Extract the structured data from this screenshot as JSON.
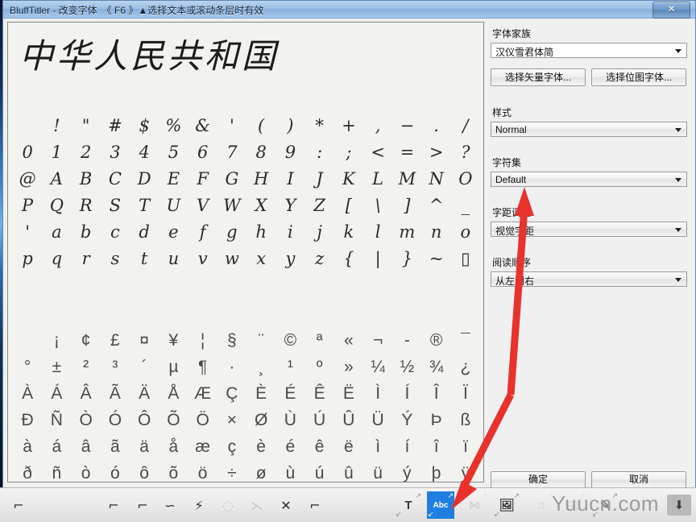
{
  "window": {
    "title": "BluffTitler - 改变字体　《 F6 》▲选择文本或滚动条层时有效",
    "close_label": "✕",
    "close_icon": "close-icon"
  },
  "preview": {
    "text": "中华人民共和国"
  },
  "charmap": {
    "columns": 16,
    "ascii_rows": [
      [
        " ",
        "!",
        "\"",
        "#",
        "$",
        "%",
        "&",
        "'",
        "(",
        ")",
        "*",
        "+",
        ",",
        "−",
        ".",
        "/"
      ],
      [
        "0",
        "1",
        "2",
        "3",
        "4",
        "5",
        "6",
        "7",
        "8",
        "9",
        ":",
        ";",
        "<",
        "=",
        ">",
        "?"
      ],
      [
        "@",
        "A",
        "B",
        "C",
        "D",
        "E",
        "F",
        "G",
        "H",
        "I",
        "J",
        "K",
        "L",
        "M",
        "N",
        "O"
      ],
      [
        "P",
        "Q",
        "R",
        "S",
        "T",
        "U",
        "V",
        "W",
        "X",
        "Y",
        "Z",
        "[",
        "\\",
        "]",
        "^",
        "_"
      ],
      [
        "'",
        "a",
        "b",
        "c",
        "d",
        "e",
        "f",
        "g",
        "h",
        "i",
        "j",
        "k",
        "l",
        "m",
        "n",
        "o"
      ],
      [
        "p",
        "q",
        "r",
        "s",
        "t",
        "u",
        "v",
        "w",
        "x",
        "y",
        "z",
        "{",
        "|",
        "}",
        "~",
        "▯"
      ]
    ],
    "latin_rows": [
      [
        " ",
        "¡",
        "¢",
        "£",
        "¤",
        "¥",
        "¦",
        "§",
        "¨",
        "©",
        "ª",
        "«",
        "¬",
        "-",
        "®",
        "¯"
      ],
      [
        "°",
        "±",
        "²",
        "³",
        "´",
        "µ",
        "¶",
        "·",
        "¸",
        "¹",
        "º",
        "»",
        "¼",
        "½",
        "¾",
        "¿"
      ],
      [
        "À",
        "Á",
        "Â",
        "Ã",
        "Ä",
        "Å",
        "Æ",
        "Ç",
        "È",
        "É",
        "Ê",
        "Ë",
        "Ì",
        "Í",
        "Î",
        "Ï"
      ],
      [
        "Ð",
        "Ñ",
        "Ò",
        "Ó",
        "Ô",
        "Õ",
        "Ö",
        "×",
        "Ø",
        "Ù",
        "Ú",
        "Û",
        "Ü",
        "Ý",
        "Þ",
        "ß"
      ],
      [
        "à",
        "á",
        "â",
        "ã",
        "ä",
        "å",
        "æ",
        "ç",
        "è",
        "é",
        "ê",
        "ë",
        "ì",
        "í",
        "î",
        "ï"
      ],
      [
        "ð",
        "ñ",
        "ò",
        "ó",
        "ô",
        "õ",
        "ö",
        "÷",
        "ø",
        "ù",
        "ú",
        "û",
        "ü",
        "ý",
        "þ",
        "ÿ"
      ]
    ]
  },
  "settings": {
    "family": {
      "label": "字体家族",
      "value": "汉仪雪君体简"
    },
    "vector_button": "选择矢量字体...",
    "bitmap_button": "选择位图字体...",
    "style": {
      "label": "样式",
      "value": "Normal"
    },
    "charset": {
      "label": "字符集",
      "value": "Default"
    },
    "kerning": {
      "label": "字距调整",
      "value": "视觉字距"
    },
    "reading": {
      "label": "阅读顺序",
      "value": "从左到右"
    },
    "ok_button": "确定",
    "cancel_button": "取消"
  },
  "toolbar": {
    "left_icons": [
      {
        "name": "layer-base-icon",
        "glyph": "⌐",
        "dim": false
      },
      {
        "name": "layer-duplicate-icon",
        "glyph": "⌐",
        "dim": false
      },
      {
        "name": "layer-cut-icon",
        "glyph": "⌐",
        "dim": false
      },
      {
        "name": "layer-curve-icon",
        "glyph": "∽",
        "dim": false
      },
      {
        "name": "layer-effect-icon",
        "glyph": "⚡",
        "dim": false
      },
      {
        "name": "layer-link-icon",
        "glyph": "◌",
        "dim": true
      },
      {
        "name": "layer-split-icon",
        "glyph": "⋋",
        "dim": true
      },
      {
        "name": "layer-delete-icon",
        "glyph": "✕",
        "dim": false
      },
      {
        "name": "layer-add-icon",
        "glyph": "⌐",
        "dim": false
      }
    ],
    "layer_buttons": [
      {
        "name": "add-text-layer-button",
        "glyph": "T",
        "selected": false,
        "faded": false
      },
      {
        "name": "add-font-layer-button",
        "glyph": "Abc",
        "selected": true,
        "faded": false
      },
      {
        "name": "add-plot-layer-button",
        "glyph": "⋈",
        "selected": false,
        "faded": true
      },
      {
        "name": "add-picture-layer-button",
        "glyph": "🖼",
        "selected": false,
        "faded": false
      },
      {
        "name": "add-audio-layer-button",
        "glyph": "♫",
        "selected": false,
        "faded": true
      },
      {
        "name": "add-model-layer-button",
        "glyph": "◰",
        "selected": false,
        "faded": true
      },
      {
        "name": "add-effect-layer-button",
        "glyph": "✎",
        "selected": false,
        "faded": false
      }
    ],
    "arrow_tr": "↗",
    "arrow_bl": "↙",
    "watermark": "Yuucn.com",
    "download_icon_glyph": "⬇"
  },
  "annotations": {
    "arrow_color": "#e8322b",
    "arrow_up_target": "字符集",
    "arrow_down_target": "Abc"
  }
}
